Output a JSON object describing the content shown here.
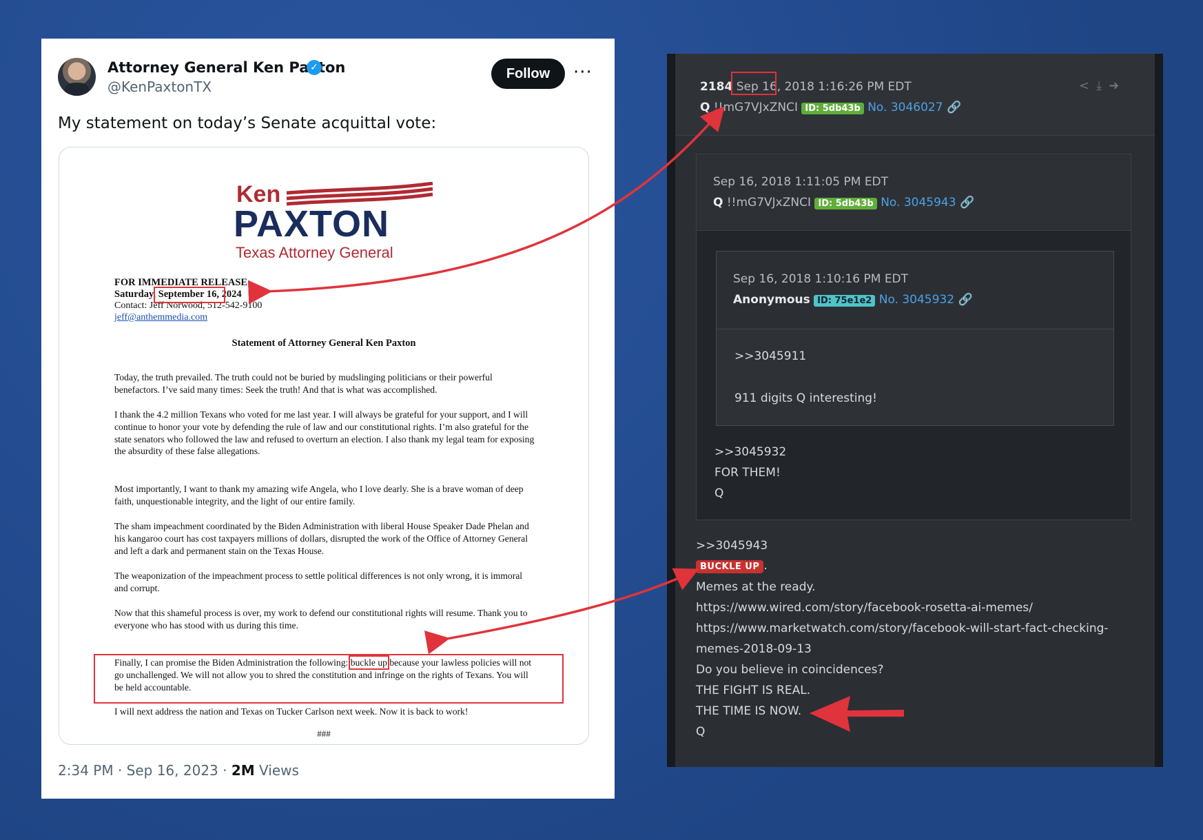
{
  "tweet": {
    "author_name": "Attorney General Ken Paxton",
    "verified_icon": "verified-badge-icon",
    "handle": "@KenPaxtonTX",
    "follow_label": "Follow",
    "more_icon": "···",
    "text": "My statement on today’s Senate acquittal vote:",
    "time": "2:34 PM · Sep 16, 2023 · ",
    "views_count": "2M",
    "views_label": " Views"
  },
  "document": {
    "logo_ken": "Ken",
    "logo_paxton": "PAXTON",
    "logo_sub": "Texas Attorney General",
    "release_head": "FOR IMMEDIATE RELEASE",
    "release_day": "Saturday, ",
    "release_date": "September 16, 2024",
    "contact": "Contact: Jeff Norwood, 512-542-9100",
    "email": "jeff@anthemmedia.com",
    "statement_title": "Statement of Attorney General Ken Paxton",
    "p1": "Today, the truth prevailed. The truth could not be buried by mudslinging politicians or their powerful benefactors.  I’ve said many times: Seek the truth!  And that is what was accomplished.",
    "p2": "I thank the 4.2 million Texans who voted for me last year. I will always be grateful for your support, and I will continue to honor your vote by defending the rule of law and our constitutional rights. I’m also grateful for the state senators who followed the law and refused to overturn an election. I also thank my legal team for exposing the absurdity of these false allegations.",
    "p3": "Most importantly, I want to thank my amazing wife Angela, who I love dearly. She is a brave woman of deep faith, unquestionable integrity, and the light of our entire family.",
    "p4": "The sham impeachment coordinated by the Biden Administration with liberal House Speaker Dade Phelan and his kangaroo court has cost taxpayers millions of dollars, disrupted the work of the Office of Attorney General and left a dark and permanent stain on the Texas House.",
    "p5": "The weaponization of the impeachment process to settle political differences is not only wrong, it is immoral and corrupt.",
    "p6": "Now that this shameful process is over, my work to defend our constitutional rights will resume. Thank you to everyone who has stood with us during this time.",
    "p7_before": "Finally, I can promise the Biden Administration the following: ",
    "p7_highlight": "buckle up",
    "p7_after": " because your lawless policies will not go unchallenged. We will not allow you to shred the constitution and infringe on the rights of Texans. You will be held accountable.",
    "p8": "I will next address the nation and Texas on Tucker Carlson next week. Now it is back to work!",
    "end_mark": "###"
  },
  "qpost": {
    "post_num": "2184",
    "date": "Sep 16, 2018 1:16:26 PM EDT",
    "author": "Q",
    "trip": "!!mG7VJxZNCI",
    "id_tag": "ID: 5db43b",
    "no": "No. 3046027",
    "action_icons": "share-icon download-icon arrow-icon",
    "reply1": {
      "date": "Sep 16, 2018 1:11:05 PM EDT",
      "author": "Q",
      "trip": "!!mG7VJxZNCI",
      "id_tag": "ID: 5db43b",
      "no": "No. 3045943",
      "lines": [
        ">>3045932",
        "FOR THEM!",
        "Q"
      ]
    },
    "reply2": {
      "date": "Sep 16, 2018 1:10:16 PM EDT",
      "author": "Anonymous",
      "id_tag": "ID: 75e1e2",
      "no": "No. 3045932",
      "ref": ">>3045911",
      "text": "911 digits Q interesting!"
    },
    "body": {
      "ref": ">>3045943",
      "tag": "BUCKLE UP",
      "tag_suffix": ".",
      "line1": "Memes at the ready.",
      "link1": "https://www.wired.com/story/facebook-rosetta-ai-memes/",
      "link2a": "https://www.marketwatch.com/story/facebook-will-start-fact-checking-",
      "link2b": "memes-2018-09-13",
      "line2": "Do you believe in coincidences?",
      "line3": "THE FIGHT IS REAL.",
      "line4": "THE TIME IS NOW.",
      "sign": "Q"
    }
  },
  "colors": {
    "background": "#244c91",
    "annotation_red": "#e0333b",
    "follow_button": "#0f1419",
    "q_panel": "#2b2f34",
    "id_tag_green": "#5fae3a",
    "id_tag_cyan": "#4fc3c7",
    "buckle_tag": "#c7322f",
    "link_blue": "#4da0e6"
  }
}
